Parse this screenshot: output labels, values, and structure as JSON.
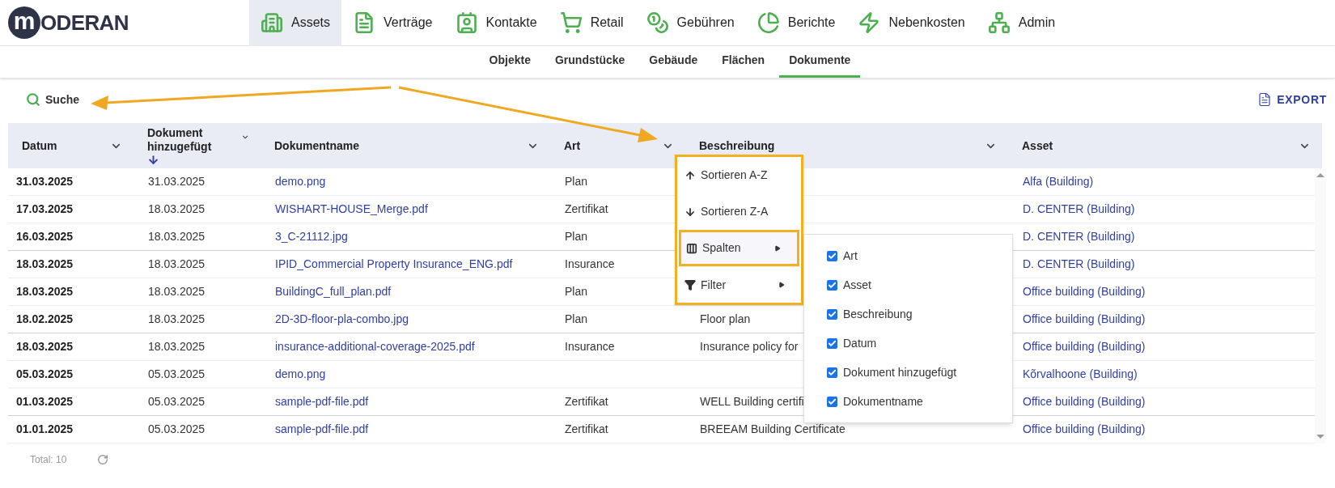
{
  "logo": {
    "mark": "m",
    "text": "ODERAN"
  },
  "nav": [
    {
      "label": "Assets",
      "kind": "building",
      "selected": true
    },
    {
      "label": "Verträge",
      "kind": "document",
      "selected": false
    },
    {
      "label": "Kontakte",
      "kind": "contact",
      "selected": false
    },
    {
      "label": "Retail",
      "kind": "cart",
      "selected": false
    },
    {
      "label": "Gebühren",
      "kind": "coins",
      "selected": false
    },
    {
      "label": "Berichte",
      "kind": "pie",
      "selected": false
    },
    {
      "label": "Nebenkosten",
      "kind": "utility",
      "selected": false
    },
    {
      "label": "Admin",
      "kind": "sitemap",
      "selected": false
    }
  ],
  "subnav": [
    {
      "label": "Objekte",
      "selected": false
    },
    {
      "label": "Grundstücke",
      "selected": false
    },
    {
      "label": "Gebäude",
      "selected": false
    },
    {
      "label": "Flächen",
      "selected": false
    },
    {
      "label": "Dokumente",
      "selected": true
    }
  ],
  "toolbar": {
    "search": "Suche",
    "export": "EXPORT"
  },
  "table": {
    "columns": [
      {
        "label": "Datum",
        "sorted": false
      },
      {
        "label": "Dokument hinzugefügt",
        "sorted": true
      },
      {
        "label": "Dokumentname",
        "sorted": false
      },
      {
        "label": "Art",
        "sorted": false
      },
      {
        "label": "Beschreibung",
        "sorted": false
      },
      {
        "label": "Asset",
        "sorted": false
      }
    ],
    "rows": [
      {
        "datum": "31.03.2025",
        "added": "31.03.2025",
        "name": "demo.png",
        "art": "Plan",
        "asset": "Alfa (Building)"
      },
      {
        "datum": "17.03.2025",
        "added": "18.03.2025",
        "name": "WISHART-HOUSE_Merge.pdf",
        "art": "Zertifikat",
        "asset": "D. CENTER (Building)"
      },
      {
        "datum": "16.03.2025",
        "added": "18.03.2025",
        "name": "3_C-21112.jpg",
        "art": "Plan",
        "asset": "D. CENTER (Building)"
      },
      {
        "datum": "18.03.2025",
        "added": "18.03.2025",
        "name": "IPID_Commercial Property Insurance_ENG.pdf",
        "art": "Insurance",
        "asset": "D. CENTER (Building)"
      },
      {
        "datum": "18.03.2025",
        "added": "18.03.2025",
        "name": "BuildingC_full_plan.pdf",
        "art": "Plan",
        "asset": "Office building (Building)"
      },
      {
        "datum": "18.02.2025",
        "added": "18.03.2025",
        "name": "2D-3D-floor-pla-combo.jpg",
        "art": "Plan",
        "beschreibung": "Floor plan",
        "asset": "Office building (Building)"
      },
      {
        "datum": "18.03.2025",
        "added": "18.03.2025",
        "name": "insurance-additional-coverage-2025.pdf",
        "art": "Insurance",
        "beschreibung": "Insurance policy for",
        "asset": "Office building (Building)"
      },
      {
        "datum": "05.03.2025",
        "added": "05.03.2025",
        "name": "demo.png",
        "asset": "Kõrvalhoone (Building)"
      },
      {
        "datum": "01.03.2025",
        "added": "05.03.2025",
        "name": "sample-pdf-file.pdf",
        "art": "Zertifikat",
        "beschreibung": "WELL Building certifi",
        "asset": "Office building (Building)"
      },
      {
        "datum": "01.01.2025",
        "added": "05.03.2025",
        "name": "sample-pdf-file.pdf",
        "art": "Zertifikat",
        "beschreibung": "BREEAM Building Certificate",
        "asset": "Office building (Building)"
      }
    ]
  },
  "footer": {
    "total": "Total: 10"
  },
  "column_menu": {
    "highlighted": true,
    "items": [
      {
        "label": "Sortieren A-Z",
        "kind": "sort_asc",
        "submenu": false,
        "highlighted": false
      },
      {
        "label": "Sortieren Z-A",
        "kind": "sort_desc",
        "submenu": false,
        "highlighted": false
      },
      {
        "label": "Spalten",
        "kind": "columns",
        "submenu": true,
        "highlighted": true
      },
      {
        "label": "Filter",
        "kind": "filter",
        "submenu": true,
        "highlighted": false
      }
    ]
  },
  "columns_submenu": [
    {
      "label": "Art",
      "checked": true
    },
    {
      "label": "Asset",
      "checked": true
    },
    {
      "label": "Beschreibung",
      "checked": true
    },
    {
      "label": "Datum",
      "checked": true
    },
    {
      "label": "Dokument hinzugefügt",
      "checked": true
    },
    {
      "label": "Dokumentname",
      "checked": true
    }
  ]
}
